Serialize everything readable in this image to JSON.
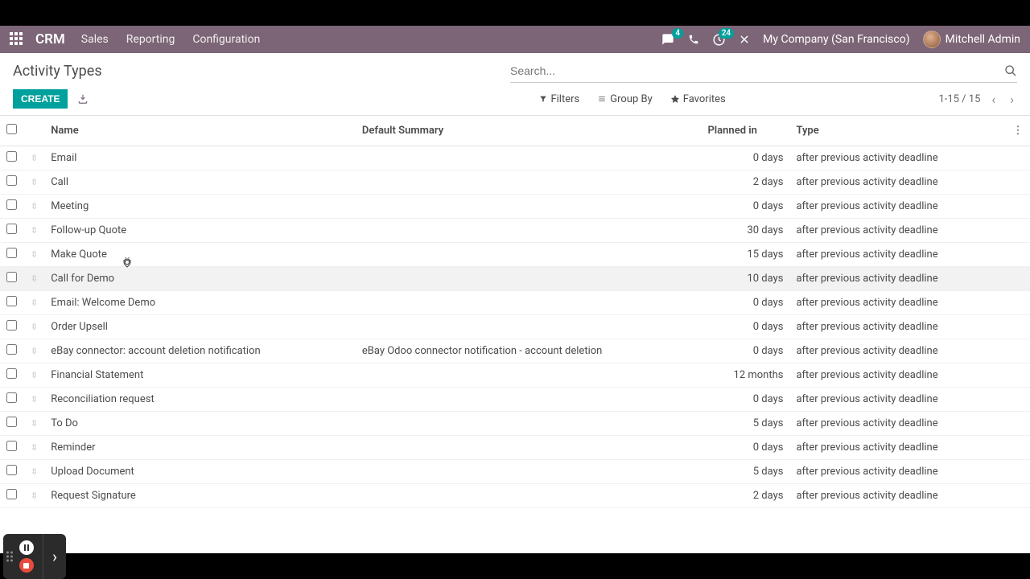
{
  "topnav": {
    "brand": "CRM",
    "links": [
      "Sales",
      "Reporting",
      "Configuration"
    ],
    "chat_badge": "4",
    "activity_badge": "24",
    "company": "My Company (San Francisco)",
    "user": "Mitchell Admin"
  },
  "page": {
    "title": "Activity Types",
    "search_placeholder": "Search...",
    "create_label": "CREATE",
    "filters_label": "Filters",
    "groupby_label": "Group By",
    "favorites_label": "Favorites",
    "pager": "1-15 / 15"
  },
  "columns": {
    "name": "Name",
    "summary": "Default Summary",
    "planned": "Planned in",
    "type": "Type"
  },
  "rows": [
    {
      "name": "Email",
      "summary": "",
      "planned": "0 days",
      "type": "after previous activity deadline"
    },
    {
      "name": "Call",
      "summary": "",
      "planned": "2 days",
      "type": "after previous activity deadline"
    },
    {
      "name": "Meeting",
      "summary": "",
      "planned": "0 days",
      "type": "after previous activity deadline"
    },
    {
      "name": "Follow-up Quote",
      "summary": "",
      "planned": "30 days",
      "type": "after previous activity deadline"
    },
    {
      "name": "Make Quote",
      "summary": "",
      "planned": "15 days",
      "type": "after previous activity deadline"
    },
    {
      "name": "Call for Demo",
      "summary": "",
      "planned": "10 days",
      "type": "after previous activity deadline"
    },
    {
      "name": "Email: Welcome Demo",
      "summary": "",
      "planned": "0 days",
      "type": "after previous activity deadline"
    },
    {
      "name": "Order Upsell",
      "summary": "",
      "planned": "0 days",
      "type": "after previous activity deadline"
    },
    {
      "name": "eBay connector: account deletion notification",
      "summary": "eBay Odoo connector notification - account deletion",
      "planned": "0 days",
      "type": "after previous activity deadline"
    },
    {
      "name": "Financial Statement",
      "summary": "",
      "planned": "12 months",
      "type": "after previous activity deadline"
    },
    {
      "name": "Reconciliation request",
      "summary": "",
      "planned": "0 days",
      "type": "after previous activity deadline"
    },
    {
      "name": "To Do",
      "summary": "",
      "planned": "5 days",
      "type": "after previous activity deadline"
    },
    {
      "name": "Reminder",
      "summary": "",
      "planned": "0 days",
      "type": "after previous activity deadline"
    },
    {
      "name": "Upload Document",
      "summary": "",
      "planned": "5 days",
      "type": "after previous activity deadline"
    },
    {
      "name": "Request Signature",
      "summary": "",
      "planned": "2 days",
      "type": "after previous activity deadline"
    }
  ],
  "hovered_row_index": 5
}
